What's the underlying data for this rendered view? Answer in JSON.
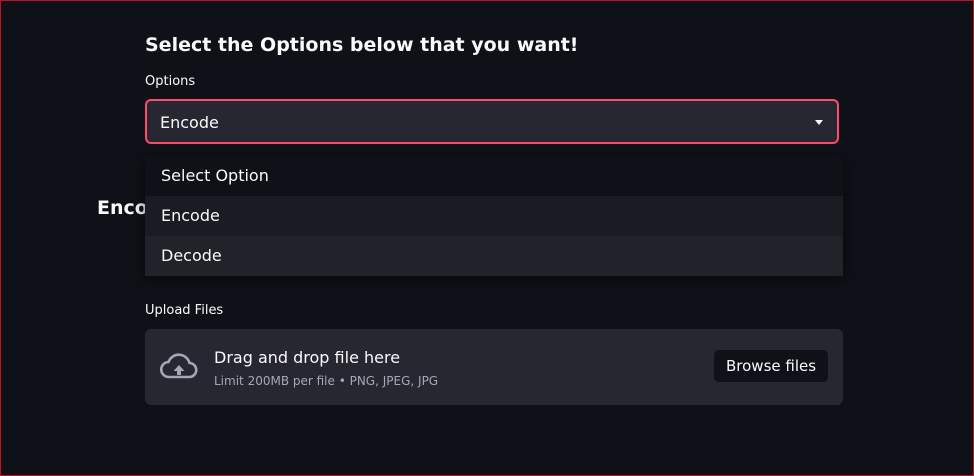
{
  "page": {
    "title": "Select the Options below that you want!"
  },
  "options": {
    "label": "Options",
    "selected_value": "Encode",
    "dropdown_open": true,
    "items": [
      {
        "label": "Select Option"
      },
      {
        "label": "Encode"
      },
      {
        "label": "Decode"
      }
    ]
  },
  "section": {
    "heading": "Encode"
  },
  "upload": {
    "label": "Upload Files",
    "dropzone_title": "Drag and drop file here",
    "limit_text": "Limit 200MB per file • PNG, JPEG, JPG",
    "browse_label": "Browse files",
    "icon": "cloud-upload-icon"
  },
  "colors": {
    "background": "#0e1117",
    "widget": "#262730",
    "accent": "#ff4b6e",
    "frame_border": "#c1121f"
  }
}
